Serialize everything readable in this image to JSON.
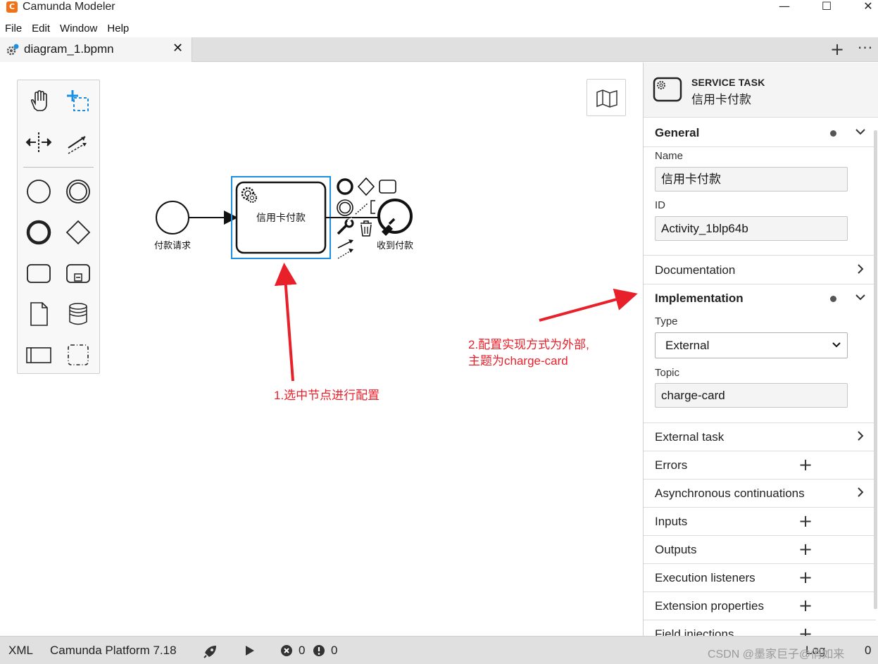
{
  "window": {
    "app_title": "Camunda Modeler",
    "app_icon_glyph": "C",
    "minimize": "—",
    "maximize": "☐",
    "close": "✕"
  },
  "menu": {
    "items": [
      "File",
      "Edit",
      "Window",
      "Help"
    ]
  },
  "tabs": {
    "active_tab": "diagram_1.bpmn",
    "close_glyph": "✕",
    "add_glyph": "+",
    "more_glyph": "···"
  },
  "diagram": {
    "start_event_label": "付款请求",
    "task_label": "信用卡付款",
    "end_event_label": "收到付款"
  },
  "annotations": {
    "step1": "1.选中节点进行配置",
    "step2_line1": "2.配置实现方式为外部,",
    "step2_line2": "主题为charge-card"
  },
  "properties": {
    "element_type": "SERVICE TASK",
    "element_name": "信用卡付款",
    "groups": {
      "general": "General",
      "documentation": "Documentation",
      "implementation": "Implementation",
      "external_task": "External task",
      "errors": "Errors",
      "async": "Asynchronous continuations",
      "inputs": "Inputs",
      "outputs": "Outputs",
      "execution_listeners": "Execution listeners",
      "extension_properties": "Extension properties",
      "field_injections": "Field injections"
    },
    "fields": {
      "name_label": "Name",
      "name_value": "信用卡付款",
      "id_label": "ID",
      "id_value": "Activity_1blp64b",
      "type_label": "Type",
      "type_value": "External",
      "topic_label": "Topic",
      "topic_value": "charge-card"
    },
    "plus_glyph": "+"
  },
  "statusbar": {
    "xml": "XML",
    "platform": "Camunda Platform 7.18",
    "errors_count": "0",
    "warnings_count": "0",
    "log_label": "Log",
    "log_count": "0",
    "watermark": "CSDN @墨家巨子@俏如来"
  },
  "colors": {
    "selection_blue": "#1a8fe3",
    "annotation_red": "#e8202a",
    "camunda_orange": "#f07117"
  }
}
